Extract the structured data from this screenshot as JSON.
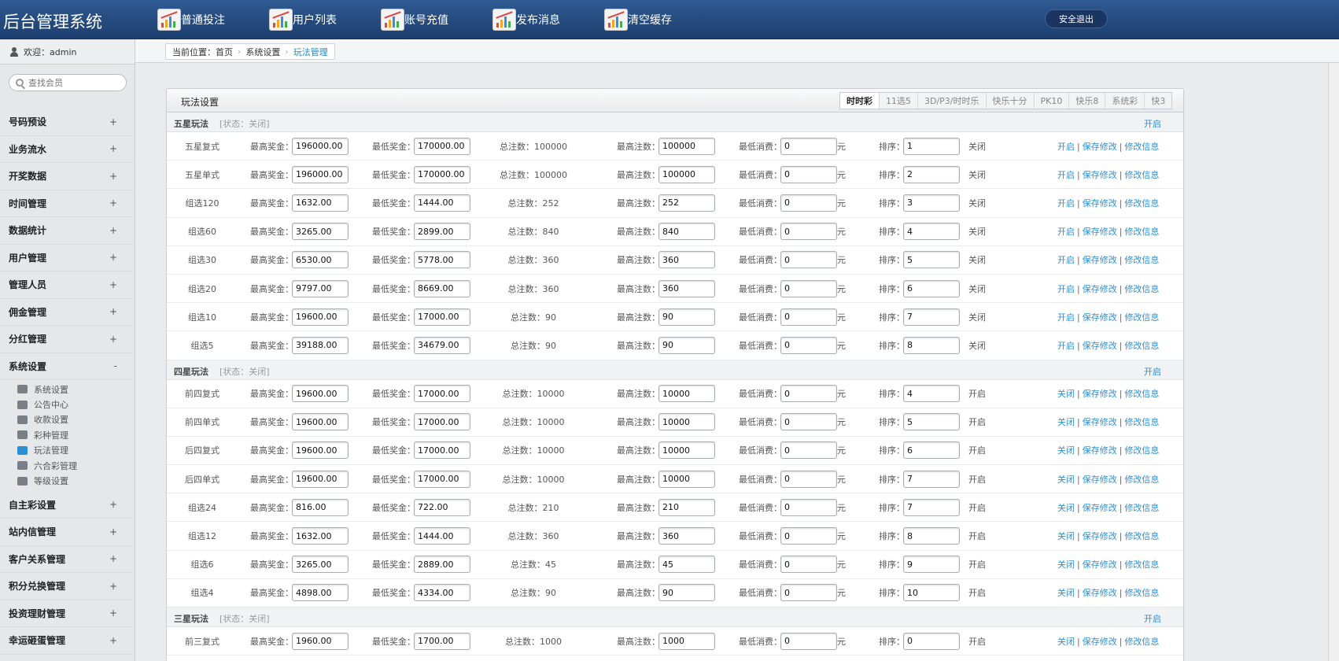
{
  "header": {
    "brand": "后台管理系统",
    "nav": [
      "普通投注",
      "用户列表",
      "账号充值",
      "发布消息",
      "清空缓存"
    ],
    "logout": "安全退出"
  },
  "sidebar": {
    "welcome": "欢迎：admin",
    "search_placeholder": "查找会员",
    "menu_top": [
      {
        "label": "号码预设",
        "toggle": "+"
      },
      {
        "label": "业务流水",
        "toggle": "+"
      },
      {
        "label": "开奖数据",
        "toggle": "+"
      },
      {
        "label": "时间管理",
        "toggle": "+"
      },
      {
        "label": "数据统计",
        "toggle": "+"
      },
      {
        "label": "用户管理",
        "toggle": "+"
      },
      {
        "label": "管理人员",
        "toggle": "+"
      },
      {
        "label": "佣金管理",
        "toggle": "+"
      },
      {
        "label": "分红管理",
        "toggle": "+"
      },
      {
        "label": "系统设置",
        "toggle": "-"
      }
    ],
    "submenu": [
      {
        "label": "系统设置",
        "icon": "wrench-icon"
      },
      {
        "label": "公告中心",
        "icon": "notice-icon"
      },
      {
        "label": "收款设置",
        "icon": "key-icon"
      },
      {
        "label": "彩种管理",
        "icon": "box-icon"
      },
      {
        "label": "玩法管理",
        "icon": "gamepad-icon",
        "active": true
      },
      {
        "label": "六合彩管理",
        "icon": "gamepad-icon"
      },
      {
        "label": "等级设置",
        "icon": "list-icon"
      }
    ],
    "menu_bottom": [
      {
        "label": "自主彩设置",
        "toggle": "+"
      },
      {
        "label": "站内信管理",
        "toggle": "+"
      },
      {
        "label": "客户关系管理",
        "toggle": "+"
      },
      {
        "label": "积分兑换管理",
        "toggle": "+"
      },
      {
        "label": "投资理财管理",
        "toggle": "+"
      },
      {
        "label": "幸运砸蛋管理",
        "toggle": "+"
      }
    ]
  },
  "breadcrumb": {
    "prefix": "当前位置：",
    "home": "首页",
    "section": "系统设置",
    "current": "玩法管理"
  },
  "panel": {
    "title": "玩法设置",
    "tabs": [
      "时时彩",
      "11选5",
      "3D/P3/时时乐",
      "快乐十分",
      "PK10",
      "快乐8",
      "系统彩",
      "快3"
    ],
    "active_tab": 0,
    "labels": {
      "max_prize": "最高奖金：",
      "min_prize": "最低奖金：",
      "total": "总注数：",
      "max_count": "最高注数：",
      "min_spend": "最低消费：",
      "unit": "元",
      "sort": "排序：",
      "status_prefix": "[状态：",
      "status_suffix": "]",
      "pipe": "|",
      "save": "保存修改",
      "edit": "修改信息"
    },
    "groups": [
      {
        "title": "五星玩法",
        "status": "关闭",
        "action": "开启",
        "rows": [
          {
            "name": "五星复式",
            "max": "196000.00",
            "min": "170000.00",
            "total": "100000",
            "max_count": "100000",
            "min_spend": "0",
            "sort": "1",
            "state": "关闭",
            "toggle": "开启"
          },
          {
            "name": "五星单式",
            "max": "196000.00",
            "min": "170000.00",
            "total": "100000",
            "max_count": "100000",
            "min_spend": "0",
            "sort": "2",
            "state": "关闭",
            "toggle": "开启"
          },
          {
            "name": "组选120",
            "max": "1632.00",
            "min": "1444.00",
            "total": "252",
            "max_count": "252",
            "min_spend": "0",
            "sort": "3",
            "state": "关闭",
            "toggle": "开启"
          },
          {
            "name": "组选60",
            "max": "3265.00",
            "min": "2899.00",
            "total": "840",
            "max_count": "840",
            "min_spend": "0",
            "sort": "4",
            "state": "关闭",
            "toggle": "开启"
          },
          {
            "name": "组选30",
            "max": "6530.00",
            "min": "5778.00",
            "total": "360",
            "max_count": "360",
            "min_spend": "0",
            "sort": "5",
            "state": "关闭",
            "toggle": "开启"
          },
          {
            "name": "组选20",
            "max": "9797.00",
            "min": "8669.00",
            "total": "360",
            "max_count": "360",
            "min_spend": "0",
            "sort": "6",
            "state": "关闭",
            "toggle": "开启"
          },
          {
            "name": "组选10",
            "max": "19600.00",
            "min": "17000.00",
            "total": "90",
            "max_count": "90",
            "min_spend": "0",
            "sort": "7",
            "state": "关闭",
            "toggle": "开启"
          },
          {
            "name": "组选5",
            "max": "39188.00",
            "min": "34679.00",
            "total": "90",
            "max_count": "90",
            "min_spend": "0",
            "sort": "8",
            "state": "关闭",
            "toggle": "开启"
          }
        ]
      },
      {
        "title": "四星玩法",
        "status": "关闭",
        "action": "开启",
        "rows": [
          {
            "name": "前四复式",
            "max": "19600.00",
            "min": "17000.00",
            "total": "10000",
            "max_count": "10000",
            "min_spend": "0",
            "sort": "4",
            "state": "开启",
            "toggle": "关闭"
          },
          {
            "name": "前四单式",
            "max": "19600.00",
            "min": "17000.00",
            "total": "10000",
            "max_count": "10000",
            "min_spend": "0",
            "sort": "5",
            "state": "开启",
            "toggle": "关闭"
          },
          {
            "name": "后四复式",
            "max": "19600.00",
            "min": "17000.00",
            "total": "10000",
            "max_count": "10000",
            "min_spend": "0",
            "sort": "6",
            "state": "开启",
            "toggle": "关闭"
          },
          {
            "name": "后四单式",
            "max": "19600.00",
            "min": "17000.00",
            "total": "10000",
            "max_count": "10000",
            "min_spend": "0",
            "sort": "7",
            "state": "开启",
            "toggle": "关闭"
          },
          {
            "name": "组选24",
            "max": "816.00",
            "min": "722.00",
            "total": "210",
            "max_count": "210",
            "min_spend": "0",
            "sort": "7",
            "state": "开启",
            "toggle": "关闭"
          },
          {
            "name": "组选12",
            "max": "1632.00",
            "min": "1444.00",
            "total": "360",
            "max_count": "360",
            "min_spend": "0",
            "sort": "8",
            "state": "开启",
            "toggle": "关闭"
          },
          {
            "name": "组选6",
            "max": "3265.00",
            "min": "2889.00",
            "total": "45",
            "max_count": "45",
            "min_spend": "0",
            "sort": "9",
            "state": "开启",
            "toggle": "关闭"
          },
          {
            "name": "组选4",
            "max": "4898.00",
            "min": "4334.00",
            "total": "90",
            "max_count": "90",
            "min_spend": "0",
            "sort": "10",
            "state": "开启",
            "toggle": "关闭"
          }
        ]
      },
      {
        "title": "三星玩法",
        "status": "关闭",
        "action": "开启",
        "rows": [
          {
            "name": "前三复式",
            "max": "1960.00",
            "min": "1700.00",
            "total": "1000",
            "max_count": "1000",
            "min_spend": "0",
            "sort": "0",
            "state": "开启",
            "toggle": "关闭"
          }
        ]
      }
    ]
  }
}
